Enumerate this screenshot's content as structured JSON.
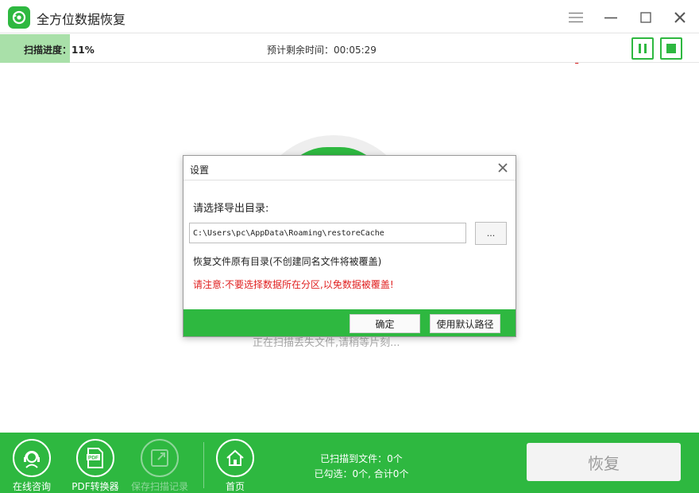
{
  "app": {
    "title": "全方位数据恢复",
    "logo_icon": "recovery-logo-icon",
    "window_controls": [
      "menu-icon",
      "minimize-icon",
      "maximize-icon",
      "close-icon"
    ]
  },
  "scan": {
    "progress_label": "扫描进度：",
    "progress_value": "11%",
    "progress_fraction": 0.11,
    "remaining_label": "预计剩余时间：",
    "remaining_time": "00:05:29",
    "pause_icon": "pause-icon",
    "stop_icon": "stop-icon",
    "status_text": "正在扫描丢失文件,请稍等片刻..."
  },
  "dialog": {
    "title": "设置",
    "prompt": "请选择导出目录:",
    "path_value": "C:\\Users\\pc\\AppData\\Roaming\\restoreCache",
    "browse_label": "...",
    "option_text": "恢复文件原有目录(不创建同名文件将被覆盖)",
    "warning_text": "请注意:不要选择数据所在分区,以免数据被覆盖!",
    "ok_label": "确定",
    "default_path_label": "使用默认路径"
  },
  "footer": {
    "tools": [
      {
        "label": "在线咨询",
        "icon": "headset-icon",
        "enabled": true
      },
      {
        "label": "PDF转换器",
        "icon": "pdf-icon",
        "enabled": true
      },
      {
        "label": "保存扫描记录",
        "icon": "save-record-icon",
        "enabled": false
      },
      {
        "label": "首页",
        "icon": "home-icon",
        "enabled": true
      }
    ],
    "scanned_files": "已扫描到文件：0个",
    "selected": "已勾选：0个, 合计0个",
    "recover_label": "恢复"
  },
  "colors": {
    "brand_green": "#2eb840",
    "progress_fill": "#a9e0a9",
    "warning_red": "#e02020"
  }
}
